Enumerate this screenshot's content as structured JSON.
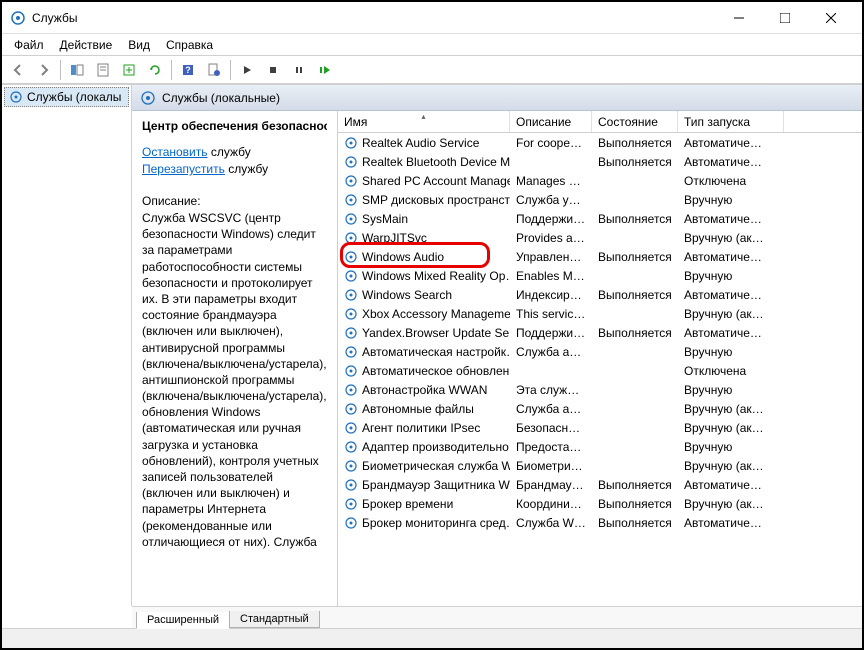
{
  "window": {
    "title": "Службы"
  },
  "menu": {
    "file": "Файл",
    "action": "Действие",
    "view": "Вид",
    "help": "Справка"
  },
  "tree": {
    "root": "Службы (локалы"
  },
  "pane": {
    "header": "Службы (локальные)"
  },
  "detail": {
    "title": "Центр обеспечения безопасности",
    "stop_link": "Остановить",
    "stop_suffix": " службу",
    "restart_link": "Перезапустить",
    "restart_suffix": " службу",
    "desc_label": "Описание:",
    "desc_text": "Служба WSCSVC (центр безопасности Windows) следит за параметрами работоспособности системы безопасности и протоколирует их. В эти параметры входит состояние брандмауэра (включен или выключен), антивирусной программы (включена/выключена/устарела), антишпионской программы (включена/выключена/устарела), обновления Windows (автоматическая или ручная загрузка и установка обновлений), контроля учетных записей пользователей (включен или выключен) и параметры Интернета (рекомендованные или отличающиеся от них). Служба"
  },
  "columns": {
    "name": "Имя",
    "desc": "Описание",
    "state": "Состояние",
    "start": "Тип запуска"
  },
  "services": [
    {
      "name": "Realtek Audio Service",
      "desc": "For cooper…",
      "state": "Выполняется",
      "start": "Автоматиче…"
    },
    {
      "name": "Realtek Bluetooth Device M…",
      "desc": "",
      "state": "Выполняется",
      "start": "Автоматиче…"
    },
    {
      "name": "Shared PC Account Manager",
      "desc": "Manages p…",
      "state": "",
      "start": "Отключена"
    },
    {
      "name": "SMP дисковых пространст…",
      "desc": "Служба уз…",
      "state": "",
      "start": "Вручную"
    },
    {
      "name": "SysMain",
      "desc": "Поддержи…",
      "state": "Выполняется",
      "start": "Автоматиче…"
    },
    {
      "name": "WarpJITSvc",
      "desc": "Provides a …",
      "state": "",
      "start": "Вручную (ак…"
    },
    {
      "name": "Windows Audio",
      "desc": "Управлен…",
      "state": "Выполняется",
      "start": "Автоматиче…"
    },
    {
      "name": "Windows Mixed Reality Op…",
      "desc": "Enables Mi…",
      "state": "",
      "start": "Вручную"
    },
    {
      "name": "Windows Search",
      "desc": "Индексир…",
      "state": "Выполняется",
      "start": "Автоматиче…"
    },
    {
      "name": "Xbox Accessory Manageme…",
      "desc": "This servic…",
      "state": "",
      "start": "Вручную (ак…"
    },
    {
      "name": "Yandex.Browser Update Ser…",
      "desc": "Поддержи…",
      "state": "Выполняется",
      "start": "Автоматиче…"
    },
    {
      "name": "Автоматическая настройк…",
      "desc": "Служба ав…",
      "state": "",
      "start": "Вручную"
    },
    {
      "name": "Автоматическое обновлен…",
      "desc": "",
      "state": "",
      "start": "Отключена"
    },
    {
      "name": "Автонастройка WWAN",
      "desc": "Эта служб…",
      "state": "",
      "start": "Вручную"
    },
    {
      "name": "Автономные файлы",
      "desc": "Служба ав…",
      "state": "",
      "start": "Вручную (ак…"
    },
    {
      "name": "Агент политики IPsec",
      "desc": "Безопасно…",
      "state": "",
      "start": "Вручную (ак…"
    },
    {
      "name": "Адаптер производительно…",
      "desc": "Предостав…",
      "state": "",
      "start": "Вручную"
    },
    {
      "name": "Биометрическая служба W…",
      "desc": "Биометри…",
      "state": "",
      "start": "Вручную (ак…"
    },
    {
      "name": "Брандмауэр Защитника W…",
      "desc": "Брандмау…",
      "state": "Выполняется",
      "start": "Автоматиче…"
    },
    {
      "name": "Брокер времени",
      "desc": "Координи…",
      "state": "Выполняется",
      "start": "Вручную (ак…"
    },
    {
      "name": "Брокер мониторинга сред…",
      "desc": "Служба W…",
      "state": "Выполняется",
      "start": "Автоматиче…"
    }
  ],
  "tabs": {
    "extended": "Расширенный",
    "standard": "Стандартный"
  }
}
